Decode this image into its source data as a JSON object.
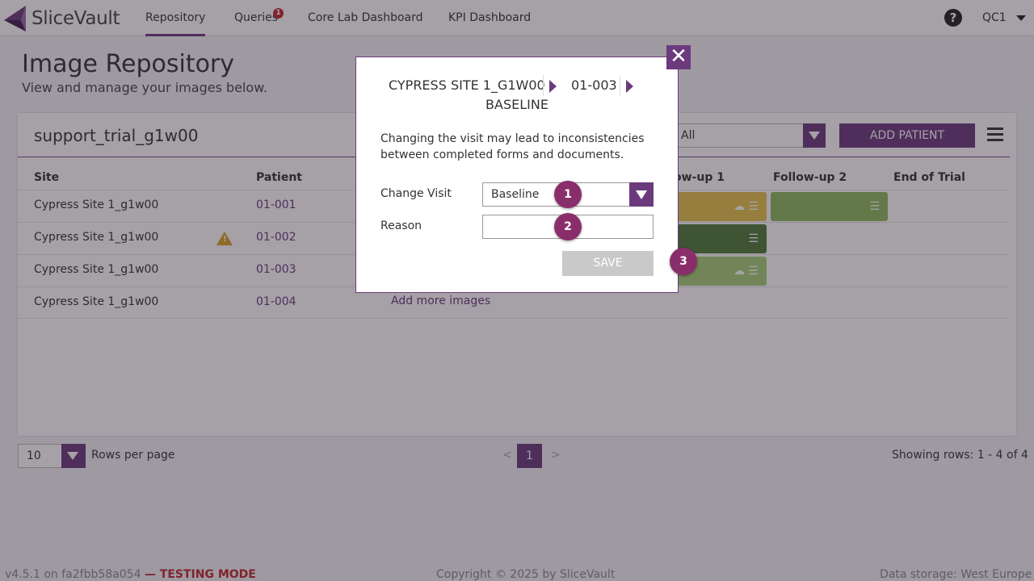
{
  "app": {
    "logo_text": "SliceVault"
  },
  "nav": {
    "items": [
      {
        "label": "Repository"
      },
      {
        "label": "Queries",
        "badge": "1"
      },
      {
        "label": "Core Lab Dashboard"
      },
      {
        "label": "KPI Dashboard"
      }
    ],
    "help": "?",
    "user": "QC1"
  },
  "page": {
    "title": "Image Repository",
    "subtitle": "View and manage your images below."
  },
  "repo": {
    "trial_name": "support_trial_g1w00",
    "filter_value": "All",
    "add_patient_label": "ADD PATIENT",
    "columns": {
      "site": "Site",
      "patient": "Patient",
      "followup1": "ow-up 1",
      "followup2": "Follow-up 2",
      "end_of_trial": "End of Trial"
    },
    "rows": [
      {
        "site": "Cypress Site 1_g1w00",
        "patient": "01-001"
      },
      {
        "site": "Cypress Site 1_g1w00",
        "patient": "01-002",
        "warning": "!"
      },
      {
        "site": "Cypress Site 1_g1w00",
        "patient": "01-003"
      },
      {
        "site": "Cypress Site 1_g1w00",
        "patient": "01-004",
        "add_more": "Add more images"
      }
    ],
    "visit_colors": {
      "yellow": "#e6c34d",
      "green": "#8fba5e",
      "dark_green": "#4f7a37",
      "light_green": "#a7cf78"
    }
  },
  "pagination": {
    "rows_per_page_value": "10",
    "rows_per_page_label": "Rows per page",
    "prev": "<",
    "current_page": "1",
    "next": ">",
    "showing": "Showing rows: 1 - 4 of 4"
  },
  "footer": {
    "version": "v4.5.1 on fa2fbb58a054",
    "mode": "— TESTING MODE",
    "copyright": "Copyright © 2025 by SliceVault",
    "storage": "Data storage: West Europe"
  },
  "modal": {
    "close": "✕",
    "breadcrumb": {
      "site": "CYPRESS SITE 1_G1W00",
      "patient": "01-003",
      "visit": "BASELINE"
    },
    "message": "Changing the visit may lead to inconsistencies between completed forms and documents.",
    "change_visit_label": "Change Visit",
    "change_visit_value": "Baseline",
    "reason_label": "Reason",
    "reason_value": "",
    "save_label": "SAVE"
  },
  "steps": [
    "1",
    "2",
    "3"
  ],
  "colors": {
    "accent": "#6b3a7d",
    "step_marker": "#8a2e6b",
    "warning": "#d9a227",
    "badge": "#c0282b"
  }
}
